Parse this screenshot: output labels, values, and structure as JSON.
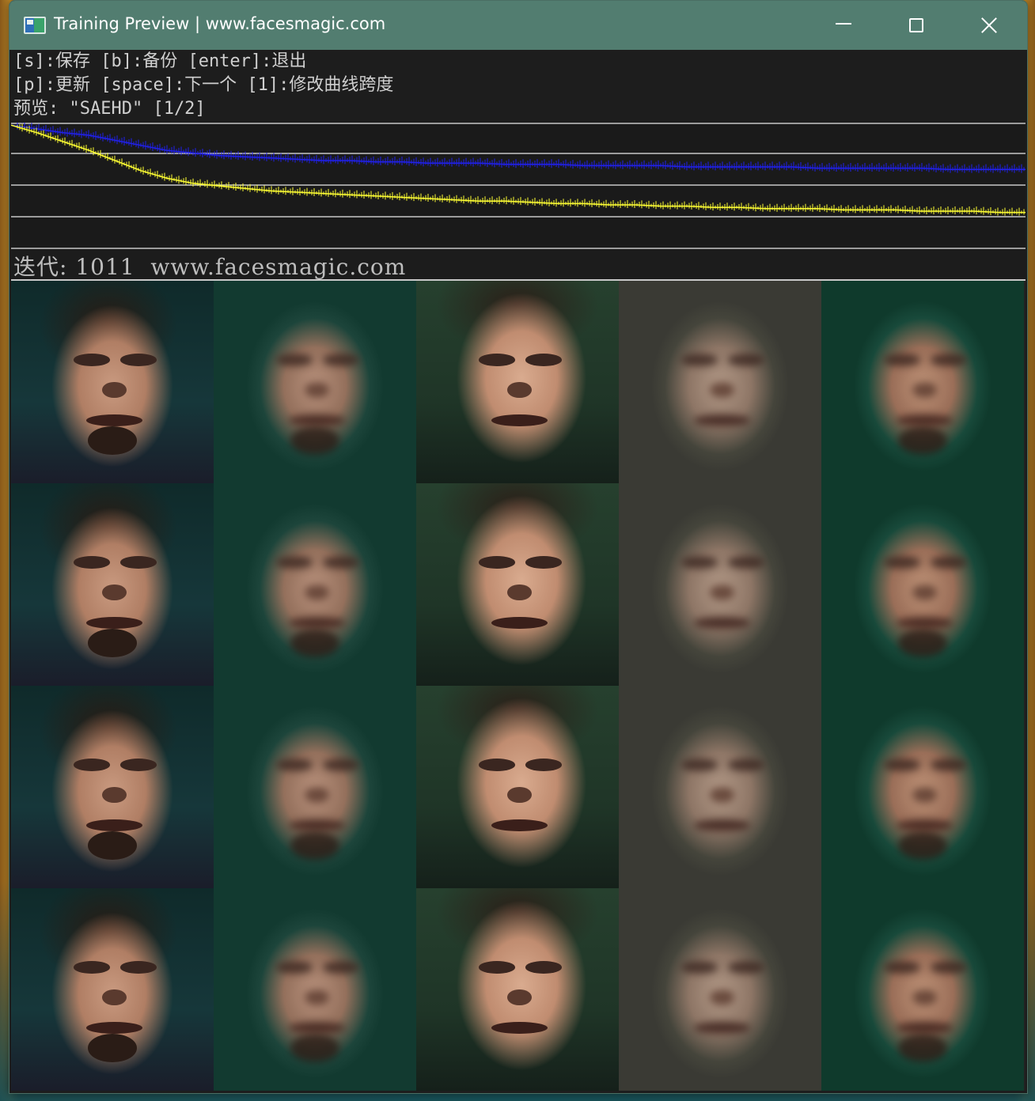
{
  "window": {
    "title": "Training Preview | www.facesmagic.com",
    "icon": "app-window-icon",
    "controls": [
      "minimize-icon",
      "maximize-icon",
      "close-icon"
    ]
  },
  "help": {
    "line1": "[s]:保存 [b]:备份 [enter]:退出",
    "line2": "[p]:更新 [space]:下一个 [1]:修改曲线跨度",
    "line3": "预览: \"SAEHD\" [1/2]"
  },
  "status": {
    "iteration_text": "迭代: 1011  www.facesmagic.com"
  },
  "colors": {
    "titlebar": "#527d70",
    "background": "#1d1d1d",
    "loss_src": "#ffff33",
    "loss_dst": "#2020ee",
    "gridline": "#c8c8c8"
  },
  "preview": {
    "columns": [
      "src",
      "src-reconstruction",
      "dst",
      "dst-reconstruction",
      "swap"
    ],
    "row_count": 4
  },
  "chart_data": {
    "type": "line",
    "series": [
      {
        "values": [
          0.98,
          0.95,
          0.92,
          0.9,
          0.86,
          0.82,
          0.78,
          0.76,
          0.74,
          0.73,
          0.72,
          0.71,
          0.7,
          0.7,
          0.69,
          0.69,
          0.68,
          0.68,
          0.68,
          0.67,
          0.67,
          0.67,
          0.66,
          0.66,
          0.66,
          0.66,
          0.65,
          0.65,
          0.65,
          0.65,
          0.65,
          0.64,
          0.64,
          0.64,
          0.64,
          0.64,
          0.63,
          0.63,
          0.63,
          0.63
        ]
      },
      {
        "values": [
          0.98,
          0.92,
          0.85,
          0.78,
          0.7,
          0.62,
          0.56,
          0.52,
          0.5,
          0.48,
          0.46,
          0.45,
          0.44,
          0.43,
          0.42,
          0.41,
          0.4,
          0.39,
          0.38,
          0.38,
          0.37,
          0.36,
          0.36,
          0.35,
          0.35,
          0.34,
          0.34,
          0.33,
          0.33,
          0.32,
          0.32,
          0.32,
          0.31,
          0.31,
          0.31,
          0.3,
          0.3,
          0.3,
          0.29,
          0.29
        ]
      }
    ],
    "ylim": [
      0,
      1
    ],
    "grid": true
  }
}
